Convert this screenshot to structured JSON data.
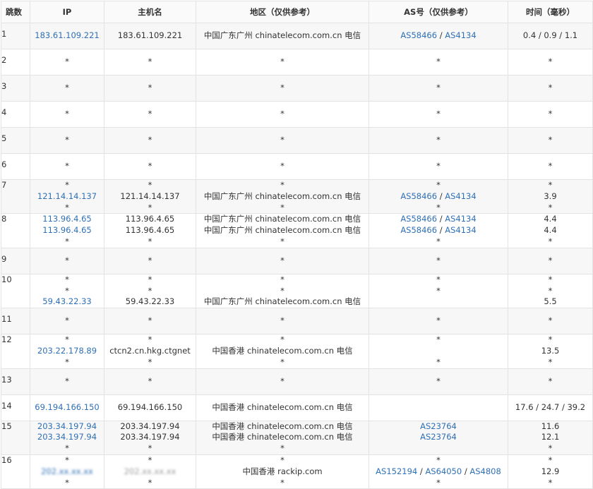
{
  "headers": {
    "hop": "跳数",
    "ip": "IP",
    "host": "主机名",
    "region": "地区（仅供参考）",
    "asn": "AS号（仅供参考）",
    "time": "时间（毫秒）"
  },
  "rows": [
    {
      "hop": "1",
      "ip": [
        "183.61.109.221"
      ],
      "host": [
        "183.61.109.221"
      ],
      "region": [
        "中国广东广州 chinatelecom.com.cn 电信"
      ],
      "asn": [
        [
          "AS58466",
          "AS4134"
        ]
      ],
      "time": [
        "0.4 / 0.9 / 1.1"
      ]
    },
    {
      "hop": "2",
      "ip": [
        "*"
      ],
      "host": [
        "*"
      ],
      "region": [
        "*"
      ],
      "asn": [
        [
          "*"
        ]
      ],
      "time": [
        "*"
      ]
    },
    {
      "hop": "3",
      "ip": [
        "*"
      ],
      "host": [
        "*"
      ],
      "region": [
        "*"
      ],
      "asn": [
        [
          "*"
        ]
      ],
      "time": [
        "*"
      ]
    },
    {
      "hop": "4",
      "ip": [
        "*"
      ],
      "host": [
        "*"
      ],
      "region": [
        "*"
      ],
      "asn": [
        [
          "*"
        ]
      ],
      "time": [
        "*"
      ]
    },
    {
      "hop": "5",
      "ip": [
        "*"
      ],
      "host": [
        "*"
      ],
      "region": [
        "*"
      ],
      "asn": [
        [
          "*"
        ]
      ],
      "time": [
        "*"
      ]
    },
    {
      "hop": "6",
      "ip": [
        "*"
      ],
      "host": [
        "*"
      ],
      "region": [
        "*"
      ],
      "asn": [
        [
          "*"
        ]
      ],
      "time": [
        "*"
      ]
    },
    {
      "hop": "7",
      "ip": [
        "*",
        "121.14.14.137",
        "*"
      ],
      "host": [
        "*",
        "121.14.14.137",
        "*"
      ],
      "region": [
        "*",
        "中国广东广州 chinatelecom.com.cn 电信",
        "*"
      ],
      "asn": [
        [
          "*"
        ],
        [
          "AS58466",
          "AS4134"
        ],
        [
          "*"
        ]
      ],
      "time": [
        "*",
        "3.9",
        "*"
      ]
    },
    {
      "hop": "8",
      "ip": [
        "113.96.4.65",
        "113.96.4.65",
        "*"
      ],
      "host": [
        "113.96.4.65",
        "113.96.4.65",
        "*"
      ],
      "region": [
        "中国广东广州 chinatelecom.com.cn 电信",
        "中国广东广州 chinatelecom.com.cn 电信",
        "*"
      ],
      "asn": [
        [
          "AS58466",
          "AS4134"
        ],
        [
          "AS58466",
          "AS4134"
        ],
        [
          "*"
        ]
      ],
      "time": [
        "4.4",
        "4.4",
        "*"
      ]
    },
    {
      "hop": "9",
      "ip": [
        "*"
      ],
      "host": [
        "*"
      ],
      "region": [
        "*"
      ],
      "asn": [
        [
          "*"
        ]
      ],
      "time": [
        "*"
      ]
    },
    {
      "hop": "10",
      "ip": [
        "*",
        "*",
        "59.43.22.33"
      ],
      "host": [
        "*",
        "*",
        "59.43.22.33"
      ],
      "region": [
        "*",
        "*",
        "中国广东广州 chinatelecom.com.cn 电信"
      ],
      "asn": [
        [
          "*"
        ],
        [
          "*"
        ],
        [
          ""
        ]
      ],
      "time": [
        "*",
        "*",
        "5.5"
      ]
    },
    {
      "hop": "11",
      "ip": [
        "*"
      ],
      "host": [
        "*"
      ],
      "region": [
        "*"
      ],
      "asn": [
        [
          "*"
        ]
      ],
      "time": [
        "*"
      ]
    },
    {
      "hop": "12",
      "ip": [
        "*",
        "203.22.178.89",
        "*"
      ],
      "host": [
        "*",
        "ctcn2.cn.hkg.ctgnet",
        "*"
      ],
      "region": [
        "*",
        "中国香港 chinatelecom.com.cn 电信",
        "*"
      ],
      "asn": [
        [
          "*"
        ],
        [
          ""
        ],
        [
          "*"
        ]
      ],
      "time": [
        "*",
        "13.5",
        "*"
      ]
    },
    {
      "hop": "13",
      "ip": [
        "*"
      ],
      "host": [
        "*"
      ],
      "region": [
        "*"
      ],
      "asn": [
        [
          "*"
        ]
      ],
      "time": [
        "*"
      ]
    },
    {
      "hop": "14",
      "ip": [
        "69.194.166.150"
      ],
      "host": [
        "69.194.166.150"
      ],
      "region": [
        "中国香港 chinatelecom.com.cn 电信"
      ],
      "asn": [
        [
          ""
        ]
      ],
      "time": [
        "17.6 / 24.7 / 39.2"
      ]
    },
    {
      "hop": "15",
      "ip": [
        "203.34.197.94",
        "203.34.197.94",
        "*"
      ],
      "host": [
        "203.34.197.94",
        "203.34.197.94",
        "*"
      ],
      "region": [
        "中国香港 chinatelecom.com.cn 电信",
        "中国香港 chinatelecom.com.cn 电信",
        "*"
      ],
      "asn": [
        [
          "AS23764"
        ],
        [
          "AS23764"
        ],
        [
          ""
        ]
      ],
      "time": [
        "11.6",
        "12.1",
        "*"
      ]
    },
    {
      "hop": "16",
      "ip": [
        "*",
        "202.xx.xx.xx",
        "*"
      ],
      "host": [
        "*",
        "202.xx.xx.xx",
        "*"
      ],
      "region": [
        "*",
        "中国香港 rackip.com",
        "*"
      ],
      "asn": [
        [
          "*"
        ],
        [
          "AS152194",
          "AS64050",
          "AS4808"
        ],
        [
          "*"
        ]
      ],
      "time": [
        "*",
        "12.9",
        "*"
      ]
    }
  ]
}
